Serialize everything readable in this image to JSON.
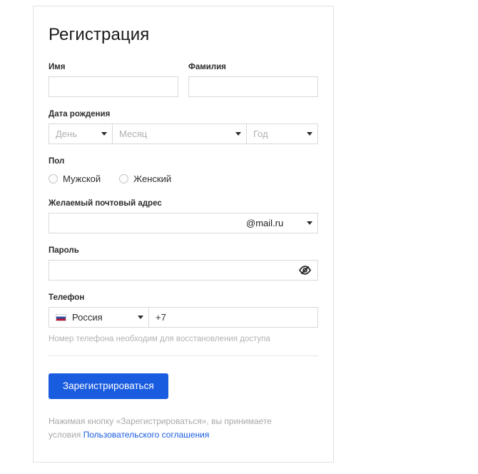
{
  "form": {
    "title": "Регистрация",
    "first_name": {
      "label": "Имя",
      "value": ""
    },
    "last_name": {
      "label": "Фамилия",
      "value": ""
    },
    "birth_date": {
      "label": "Дата рождения",
      "day_placeholder": "День",
      "month_placeholder": "Месяц",
      "year_placeholder": "Год"
    },
    "gender": {
      "label": "Пол",
      "options": [
        {
          "label": "Мужской",
          "selected": false
        },
        {
          "label": "Женский",
          "selected": false
        }
      ]
    },
    "email": {
      "label": "Желаемый почтовый адрес",
      "value": "",
      "domain": "@mail.ru"
    },
    "password": {
      "label": "Пароль",
      "value": "",
      "toggle_icon": "eye-slash-icon"
    },
    "phone": {
      "label": "Телефон",
      "country": "Россия",
      "country_flag": "russia-flag-icon",
      "prefix": "+7",
      "value": "",
      "hint": "Номер телефона необходим для восстановления доступа"
    }
  },
  "footer": {
    "submit_label": "Зарегистрироваться",
    "terms_prefix": "Нажимая кнопку «Зарегистрироваться», вы принимаете условия ",
    "terms_link": "Пользовательского соглашения"
  },
  "colors": {
    "accent": "#1a5ce0",
    "border": "#d9d9d9",
    "placeholder": "#b0b0b0",
    "hint": "#b3b3b3"
  }
}
